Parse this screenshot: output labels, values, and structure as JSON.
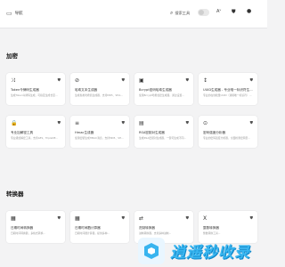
{
  "header": {
    "brand_name": "导航",
    "search_label": "搜索工具",
    "lang_label": "A",
    "icons": {
      "logo": "logo-icon",
      "search": "search-icon",
      "lang": "language-icon",
      "shield": "shield-icon",
      "user": "user-icon"
    }
  },
  "sections": [
    {
      "title": "加密",
      "cards": [
        {
          "icon": "shuffle-icon",
          "glyph": "⤨",
          "title": "Token令牌码生成器",
          "desc": "生成Token令牌码生成，可指定生成长度..."
        },
        {
          "icon": "eye-off-icon",
          "glyph": "⊘",
          "title": "哈希文本生成器",
          "desc": "生成各类哈希值生成器，支持MD5、SHA..."
        },
        {
          "icon": "lock-icon",
          "glyph": "▣",
          "title": "Bcrypt密码哈希生成器",
          "desc": "使用Bcrypt哈希加密生成器，通过设置..."
        },
        {
          "icon": "sort-icon",
          "glyph": "↕",
          "title": "UUID生成器 - 专业唯一标识符生...",
          "desc": "专业的在线批量UUID（通用唯一标识符）..."
        },
        {
          "icon": "lock-icon",
          "glyph": "🔒",
          "title": "专业加解密工具",
          "desc": "专业级加解密工具，支持AES、TripleDE..."
        },
        {
          "icon": "menu-icon",
          "glyph": "≡",
          "title": "Hmac生成器",
          "desc": "使用密钥生成HMAC消息，支持MD5、SH..."
        },
        {
          "icon": "file-key-icon",
          "glyph": "▤",
          "title": "RSA密钥对生成器",
          "desc": "生成RSA密钥对生成器，一键可生成不同..."
        },
        {
          "icon": "key-icon",
          "glyph": "⊙",
          "title": "密码强度分析器",
          "desc": "专业的密码强度分析器，全面检测密码安..."
        }
      ]
    },
    {
      "title": "转换器",
      "cards": [
        {
          "icon": "calendar-icon",
          "glyph": "▦",
          "title": "日期时间转换器",
          "desc": "日期时间转换器，多格式转换..."
        },
        {
          "icon": "calendar-icon",
          "glyph": "▦",
          "title": "日期时间戳计算器",
          "desc": "日期时间戳计算器，提供多种..."
        },
        {
          "icon": "swap-icon",
          "glyph": "⇄",
          "title": "进制转换器",
          "desc": "进制转换器，支持多种进制..."
        },
        {
          "icon": "binary-icon",
          "glyph": "X",
          "title": "整数转换器",
          "desc": "整数转换工具..."
        }
      ]
    }
  ],
  "watermark": {
    "text": "逍遥秒收录",
    "icon": "watermark-logo-icon"
  }
}
